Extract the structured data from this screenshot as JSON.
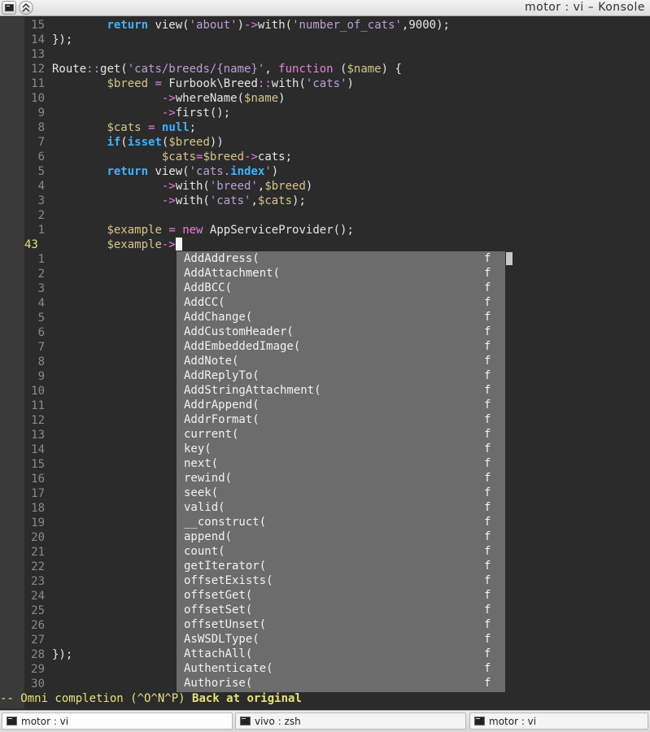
{
  "window": {
    "title": "motor : vi – Konsole"
  },
  "editor": {
    "lines": [
      {
        "num": "15",
        "html": "        <span class=\"kw\">return</span> view(<span class=\"str\">'about'</span>)<span class=\"op\">-&gt;</span>with(<span class=\"str\">'number_of_cats'</span>,9000);"
      },
      {
        "num": "14",
        "html": "});"
      },
      {
        "num": "13",
        "html": ""
      },
      {
        "num": "12",
        "html": "Route<span class=\"op\">::</span>get(<span class=\"str\">'cats/breeds/{name}'</span>, <span class=\"op\">function</span> (<span class=\"var\">$name</span>) {"
      },
      {
        "num": "11",
        "html": "        <span class=\"var\">$breed</span> <span class=\"op\">=</span> Furbook\\Breed<span class=\"op\">::</span>with(<span class=\"str\">'cats'</span>)"
      },
      {
        "num": "10",
        "html": "                <span class=\"op\">-&gt;</span>whereName(<span class=\"var\">$name</span>)"
      },
      {
        "num": "9",
        "html": "                <span class=\"op\">-&gt;</span>first();"
      },
      {
        "num": "8",
        "html": "        <span class=\"var\">$cats</span> <span class=\"op\">=</span> <span class=\"kw\">null</span>;"
      },
      {
        "num": "7",
        "html": "        <span class=\"kw\">if</span>(<span class=\"kw\">isset</span>(<span class=\"var\">$breed</span>))"
      },
      {
        "num": "6",
        "html": "                <span class=\"var\">$cats</span><span class=\"op\">=</span><span class=\"var\">$breed</span><span class=\"op\">-&gt;</span>cats;"
      },
      {
        "num": "5",
        "html": "        <span class=\"kw\">return</span> view(<span class=\"str\">'cats.</span><span class=\"kw\">index</span><span class=\"str\">'</span>)"
      },
      {
        "num": "4",
        "html": "                <span class=\"op\">-&gt;</span>with(<span class=\"str\">'breed'</span>,<span class=\"var\">$breed</span>)"
      },
      {
        "num": "3",
        "html": "                <span class=\"op\">-&gt;</span>with(<span class=\"str\">'cats'</span>,<span class=\"var\">$cats</span>);"
      },
      {
        "num": "2",
        "html": ""
      },
      {
        "num": "1",
        "html": "        <span class=\"var\">$example</span> <span class=\"op\">=</span> <span class=\"op\">new</span> AppServiceProvider();"
      },
      {
        "num": "43",
        "current": true,
        "html": "        <span class=\"var\">$example</span><span class=\"op\">-&gt;</span><span id=\"cursor\"></span>"
      },
      {
        "num": "1",
        "html": ""
      },
      {
        "num": "2",
        "html": ""
      },
      {
        "num": "3",
        "html": ""
      },
      {
        "num": "4",
        "html": ""
      },
      {
        "num": "5",
        "html": ""
      },
      {
        "num": "6",
        "html": ""
      },
      {
        "num": "7",
        "html": ""
      },
      {
        "num": "8",
        "html": ""
      },
      {
        "num": "9",
        "html": ""
      },
      {
        "num": "10",
        "html": ""
      },
      {
        "num": "11",
        "html": ""
      },
      {
        "num": "12",
        "html": ""
      },
      {
        "num": "13",
        "html": ""
      },
      {
        "num": "14",
        "html": ""
      },
      {
        "num": "15",
        "html": ""
      },
      {
        "num": "16",
        "html": ""
      },
      {
        "num": "17",
        "html": ""
      },
      {
        "num": "18",
        "html": ""
      },
      {
        "num": "19",
        "html": ""
      },
      {
        "num": "20",
        "html": ""
      },
      {
        "num": "21",
        "html": ""
      },
      {
        "num": "22",
        "html": ""
      },
      {
        "num": "23",
        "html": ""
      },
      {
        "num": "24",
        "html": ""
      },
      {
        "num": "25",
        "html": ""
      },
      {
        "num": "26",
        "html": ""
      },
      {
        "num": "27",
        "html": ""
      },
      {
        "num": "28",
        "html": "});"
      },
      {
        "num": "29",
        "html": ""
      },
      {
        "num": "30",
        "html": ""
      }
    ]
  },
  "completion": {
    "items": [
      {
        "text": "AddAddress(",
        "kind": "f"
      },
      {
        "text": "AddAttachment(",
        "kind": "f"
      },
      {
        "text": "AddBCC(",
        "kind": "f"
      },
      {
        "text": "AddCC(",
        "kind": "f"
      },
      {
        "text": "AddChange(",
        "kind": "f"
      },
      {
        "text": "AddCustomHeader(",
        "kind": "f"
      },
      {
        "text": "AddEmbeddedImage(",
        "kind": "f"
      },
      {
        "text": "AddNote(",
        "kind": "f"
      },
      {
        "text": "AddReplyTo(",
        "kind": "f"
      },
      {
        "text": "AddStringAttachment(",
        "kind": "f"
      },
      {
        "text": "AddrAppend(",
        "kind": "f"
      },
      {
        "text": "AddrFormat(",
        "kind": "f"
      },
      {
        "text": "current(",
        "kind": "f"
      },
      {
        "text": "key(",
        "kind": "f"
      },
      {
        "text": "next(",
        "kind": "f"
      },
      {
        "text": "rewind(",
        "kind": "f"
      },
      {
        "text": "seek(",
        "kind": "f"
      },
      {
        "text": "valid(",
        "kind": "f"
      },
      {
        "text": "__construct(",
        "kind": "f"
      },
      {
        "text": "append(",
        "kind": "f"
      },
      {
        "text": "count(",
        "kind": "f"
      },
      {
        "text": "getIterator(",
        "kind": "f"
      },
      {
        "text": "offsetExists(",
        "kind": "f"
      },
      {
        "text": "offsetGet(",
        "kind": "f"
      },
      {
        "text": "offsetSet(",
        "kind": "f"
      },
      {
        "text": "offsetUnset(",
        "kind": "f"
      },
      {
        "text": "AsWSDLType(",
        "kind": "f"
      },
      {
        "text": "AttachAll(",
        "kind": "f"
      },
      {
        "text": "Authenticate(",
        "kind": "f"
      },
      {
        "text": "Authorise(",
        "kind": "f"
      }
    ]
  },
  "status": {
    "mode_text": "-- Omni completion (^O^N^P) ",
    "message": "Back at original"
  },
  "tabs": [
    {
      "label": "motor : vi"
    },
    {
      "label": "vivo : zsh"
    },
    {
      "label": "motor : vi"
    }
  ]
}
